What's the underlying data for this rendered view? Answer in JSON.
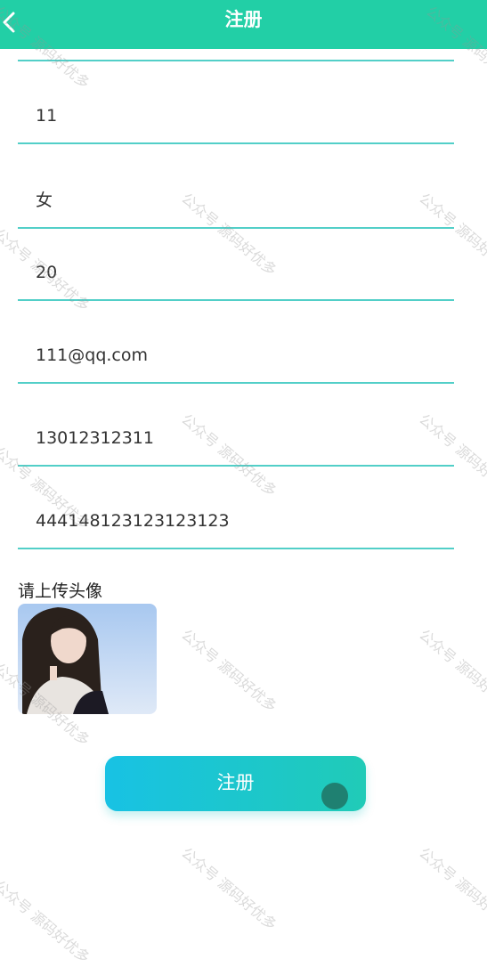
{
  "header": {
    "title": "注册",
    "back_icon": "chevron-left-icon",
    "bg_color": "#22cfa6"
  },
  "form": {
    "fields": [
      {
        "value": "11"
      },
      {
        "value": "女"
      },
      {
        "value": "20"
      },
      {
        "value": "111@qq.com"
      },
      {
        "value": "13012312311"
      },
      {
        "value": "444148123123123123"
      }
    ],
    "upload_label": "请上传头像",
    "line_color": "#52cfc8"
  },
  "submit": {
    "label": "注册"
  },
  "watermark": {
    "text": "公众号 源码好优多"
  }
}
